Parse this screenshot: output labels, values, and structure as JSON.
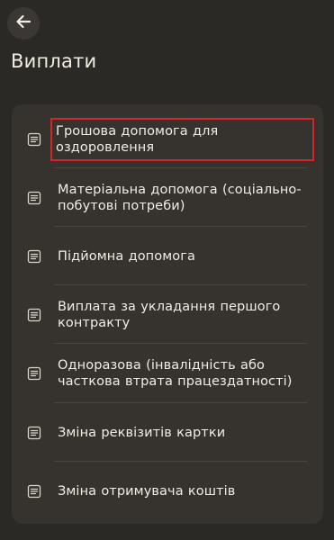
{
  "header": {
    "back_icon": "arrow-left-icon",
    "title": "Виплати"
  },
  "menu": {
    "items": [
      {
        "label": "Грошова допомога для оздоровлення",
        "icon": "document-icon",
        "highlighted": true
      },
      {
        "label": "Матеріальна допомога (соціально-побутові потреби)",
        "icon": "document-icon"
      },
      {
        "label": "Підйомна допомога",
        "icon": "document-icon"
      },
      {
        "label": "Виплата за укладання першого контракту",
        "icon": "document-icon"
      },
      {
        "label": "Одноразова (інвалідність або часткова втрата працездатності)",
        "icon": "document-icon"
      },
      {
        "label": "Зміна реквізитів картки",
        "icon": "document-icon"
      },
      {
        "label": "Зміна отримувача коштів",
        "icon": "document-icon"
      }
    ]
  },
  "colors": {
    "background": "#2b2925",
    "card": "#36332f",
    "text": "#f2ede3",
    "highlight_border": "#d2262b"
  }
}
